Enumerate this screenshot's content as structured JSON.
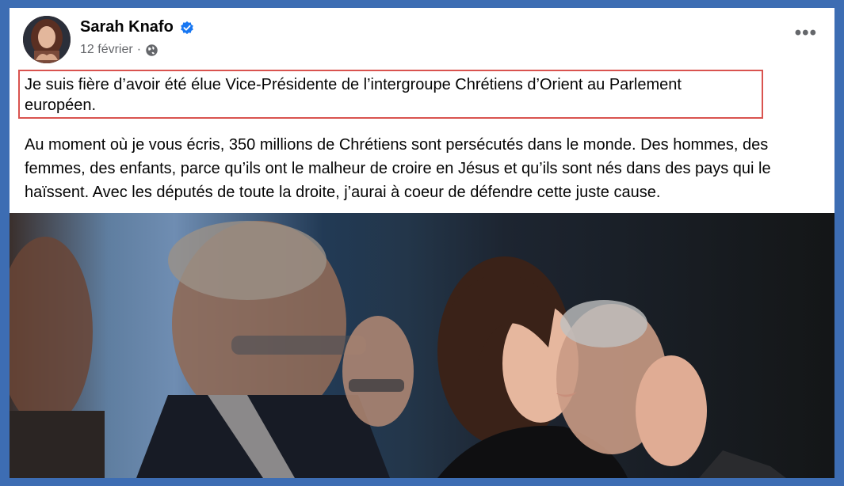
{
  "post": {
    "author": "Sarah Knafo",
    "date": "12 février",
    "separator": "·",
    "privacy_icon": "globe-icon",
    "verified_icon": "verified-badge-icon",
    "more_icon": "more-options-icon",
    "more_label": "•••",
    "highlighted_text": "Je suis fière d’avoir été élue Vice-Présidente de l’intergroupe Chrétiens d’Orient au Parlement européen.",
    "body_text": "Au moment où je vous écris, 350 millions de Chrétiens sont persécutés dans le monde. Des hommes, des femmes, des enfants, parce qu’ils ont le malheur de croire en Jésus et qu’ils sont nés dans des pays qui le haïssent. Avec les députés de toute la droite, j’aurai à coeur de défendre cette juste cause."
  },
  "colors": {
    "border_blue": "#3d6db3",
    "highlight_red": "#d9534f",
    "verified_blue": "#1877f2"
  }
}
